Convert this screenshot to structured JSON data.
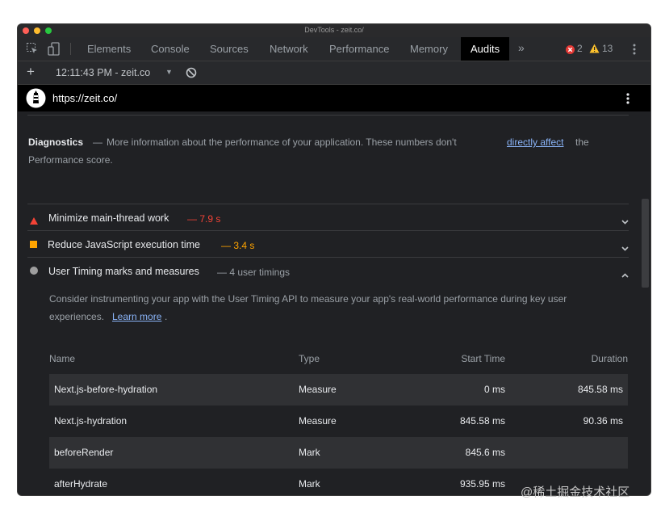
{
  "window": {
    "title": "DevTools - zeit.co/"
  },
  "tabs": [
    {
      "label": "Elements"
    },
    {
      "label": "Console"
    },
    {
      "label": "Sources"
    },
    {
      "label": "Network"
    },
    {
      "label": "Performance"
    },
    {
      "label": "Memory"
    },
    {
      "label": "Audits"
    }
  ],
  "badges": {
    "errors": "2",
    "warnings": "13"
  },
  "subbar": {
    "add": "+",
    "session": "12:11:43 PM - zeit.co"
  },
  "urlbar": {
    "url": "https://zeit.co/"
  },
  "diagnostics": {
    "title": "Diagnostics",
    "dash": "—",
    "desc": "More information about the performance of your application. These numbers don't",
    "link": "directly affect",
    "after_link": "the",
    "line2": "Performance score."
  },
  "audits": [
    {
      "title": "Minimize main-thread work",
      "value": "— 7.9 s",
      "status": "fail",
      "color": "#f44336"
    },
    {
      "title": "Reduce JavaScript execution time",
      "value": "— 3.4 s",
      "status": "average",
      "color": "#ffa400"
    },
    {
      "title": "User Timing marks and measures",
      "value": "— 4 user timings",
      "status": "info",
      "color": "#9e9e9e"
    }
  ],
  "user_timing": {
    "desc1": "Consider instrumenting your app with the User Timing API to measure your app's real-world performance during key user",
    "desc2": "experiences.",
    "learn_more": "Learn more",
    "period": ".",
    "headers": {
      "name": "Name",
      "type": "Type",
      "start": "Start Time",
      "duration": "Duration"
    },
    "rows": [
      {
        "name": "Next.js-before-hydration",
        "type": "Measure",
        "start": "0 ms",
        "duration": "845.58 ms"
      },
      {
        "name": "Next.js-hydration",
        "type": "Measure",
        "start": "845.58 ms",
        "duration": "90.36 ms"
      },
      {
        "name": "beforeRender",
        "type": "Mark",
        "start": "845.6 ms",
        "duration": ""
      },
      {
        "name": "afterHydrate",
        "type": "Mark",
        "start": "935.95 ms",
        "duration": ""
      }
    ]
  },
  "watermark": "@稀土掘金技术社区"
}
